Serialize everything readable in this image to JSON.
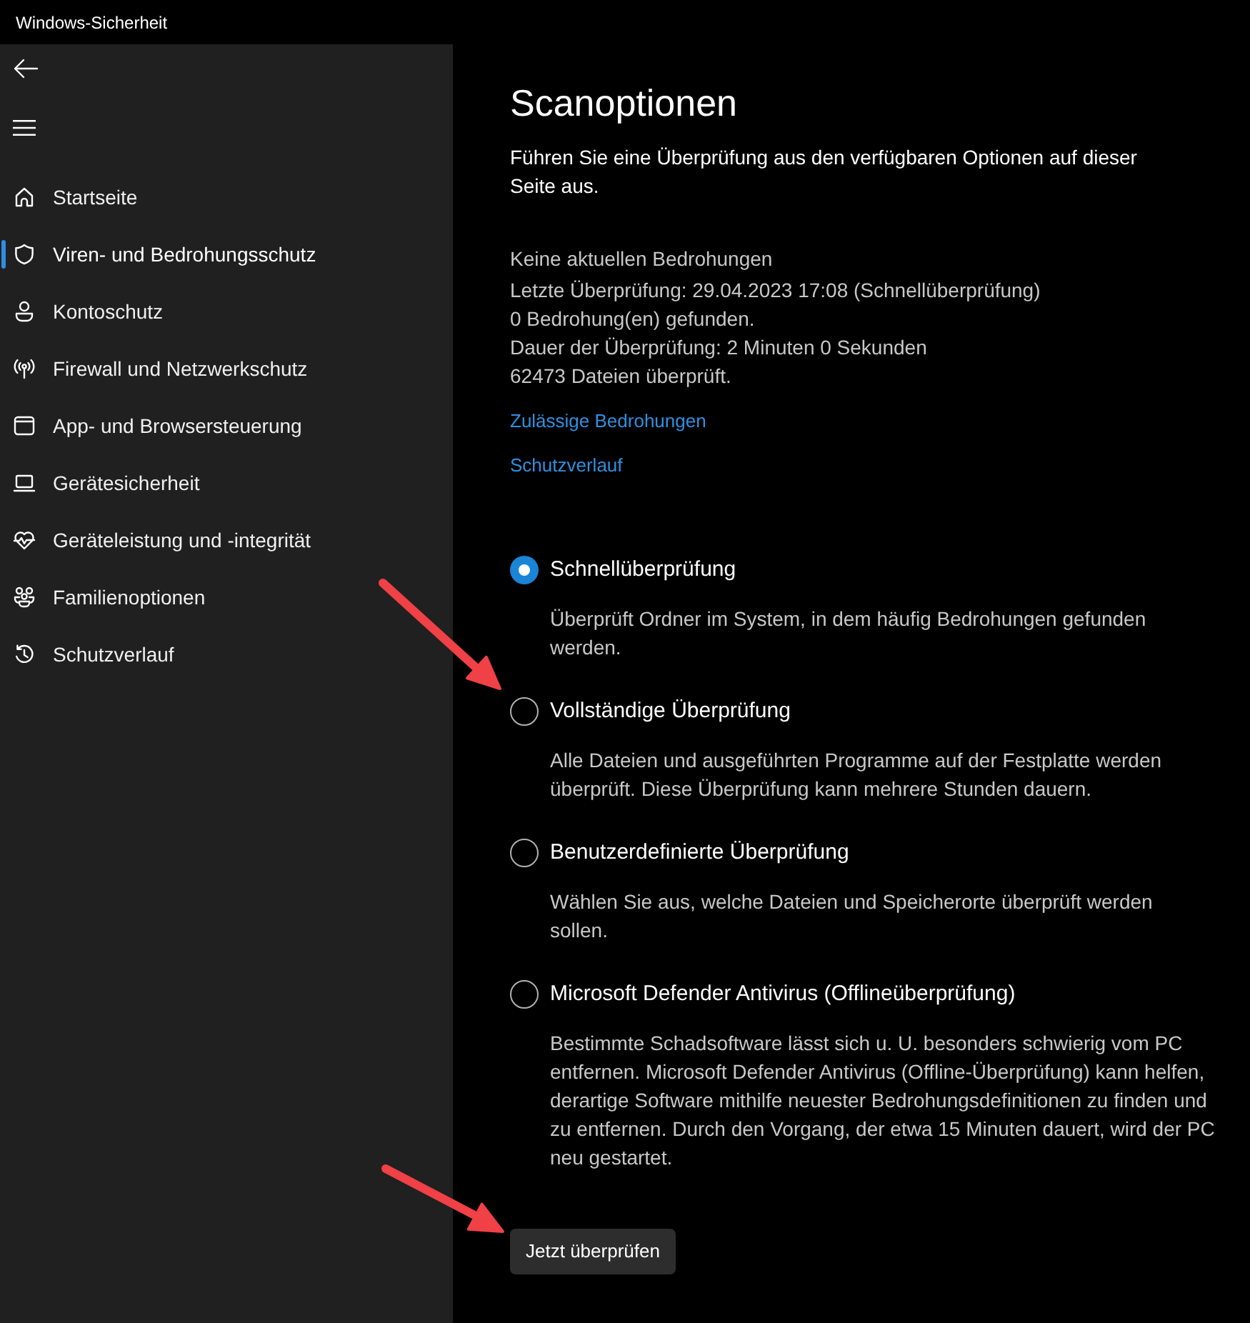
{
  "window": {
    "title": "Windows-Sicherheit"
  },
  "sidebar": {
    "items": [
      {
        "label": "Startseite",
        "selected": false
      },
      {
        "label": "Viren- und Bedrohungsschutz",
        "selected": true
      },
      {
        "label": "Kontoschutz",
        "selected": false
      },
      {
        "label": "Firewall und Netzwerkschutz",
        "selected": false
      },
      {
        "label": "App- und Browsersteuerung",
        "selected": false
      },
      {
        "label": "Gerätesicherheit",
        "selected": false
      },
      {
        "label": "Geräteleistung und -integrität",
        "selected": false
      },
      {
        "label": "Familienoptionen",
        "selected": false
      },
      {
        "label": "Schutzverlauf",
        "selected": false
      }
    ]
  },
  "page": {
    "title": "Scanoptionen",
    "description": "Führen Sie eine Überprüfung aus den verfügbaren Optionen auf dieser Seite aus.",
    "status": {
      "heading": "Keine aktuellen Bedrohungen",
      "lines": [
        "Letzte Überprüfung: 29.04.2023 17:08 (Schnellüberprüfung)",
        "0 Bedrohung(en) gefunden.",
        "Dauer der Überprüfung: 2 Minuten 0 Sekunden",
        "62473 Dateien überprüft."
      ]
    },
    "links": [
      "Zulässige Bedrohungen",
      "Schutzverlauf"
    ],
    "scan_options": [
      {
        "label": "Schnellüberprüfung",
        "description": "Überprüft Ordner im System, in dem häufig Bedrohungen gefunden werden.",
        "selected": true
      },
      {
        "label": "Vollständige Überprüfung",
        "description": "Alle Dateien und ausgeführten Programme auf der Festplatte werden überprüft. Diese Überprüfung kann mehrere Stunden dauern.",
        "selected": false
      },
      {
        "label": "Benutzerdefinierte Überprüfung",
        "description": "Wählen Sie aus, welche Dateien und Speicherorte überprüft werden sollen.",
        "selected": false
      },
      {
        "label": "Microsoft Defender Antivirus (Offlineüberprüfung)",
        "description": "Bestimmte Schadsoftware lässt sich u. U. besonders schwierig vom PC entfernen. Microsoft Defender Antivirus (Offline-Überprüfung) kann helfen, derartige Software mithilfe neuester Bedrohungsdefinitionen zu finden und zu entfernen. Durch den Vorgang, der etwa 15 Minuten dauert, wird der PC neu gestartet.",
        "selected": false
      }
    ],
    "button": "Jetzt überprüfen"
  },
  "annotations": [
    {
      "kind": "arrow"
    },
    {
      "kind": "arrow"
    }
  ]
}
